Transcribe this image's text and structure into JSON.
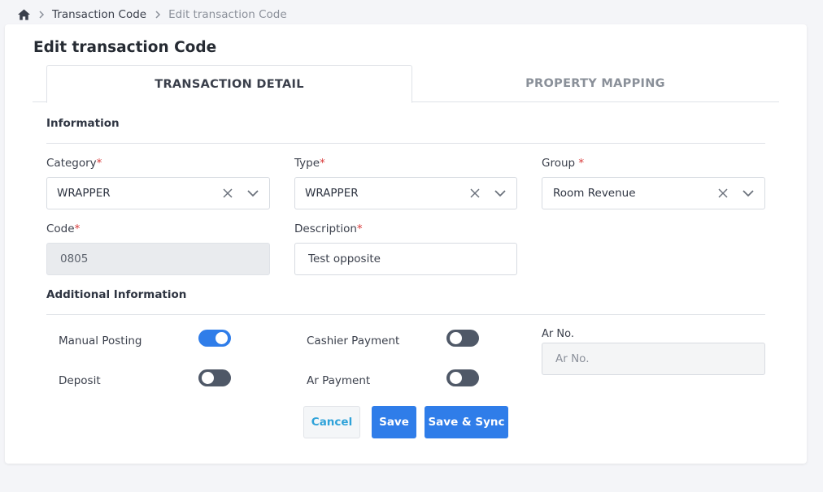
{
  "breadcrumb": {
    "home_icon": "home-icon",
    "items": [
      "Transaction Code",
      "Edit transaction Code"
    ]
  },
  "page": {
    "title": "Edit transaction Code"
  },
  "tabs": [
    {
      "label": "TRANSACTION DETAIL",
      "active": true
    },
    {
      "label": "PROPERTY MAPPING",
      "active": false
    }
  ],
  "information": {
    "title": "Information",
    "category": {
      "label": "Category",
      "value": "WRAPPER"
    },
    "type": {
      "label": "Type",
      "value": "WRAPPER"
    },
    "group": {
      "label": "Group ",
      "value": "Room Revenue"
    },
    "code": {
      "label": "Code",
      "value": "0805"
    },
    "description": {
      "label": "Description",
      "value": "Test opposite"
    }
  },
  "additional": {
    "title": "Additional Information",
    "manual_posting": {
      "label": "Manual Posting",
      "on": true
    },
    "deposit": {
      "label": "Deposit",
      "on": false
    },
    "cashier_payment": {
      "label": "Cashier Payment",
      "on": false
    },
    "ar_payment": {
      "label": "Ar Payment",
      "on": false
    },
    "ar_no": {
      "label": "Ar No.",
      "placeholder": "Ar No."
    }
  },
  "actions": {
    "cancel": "Cancel",
    "save": "Save",
    "save_sync": "Save & Sync"
  },
  "colors": {
    "primary": "#2f7de9",
    "toggle_off": "#4f5867",
    "required": "#d93a3a",
    "link": "#2fa2d9"
  }
}
